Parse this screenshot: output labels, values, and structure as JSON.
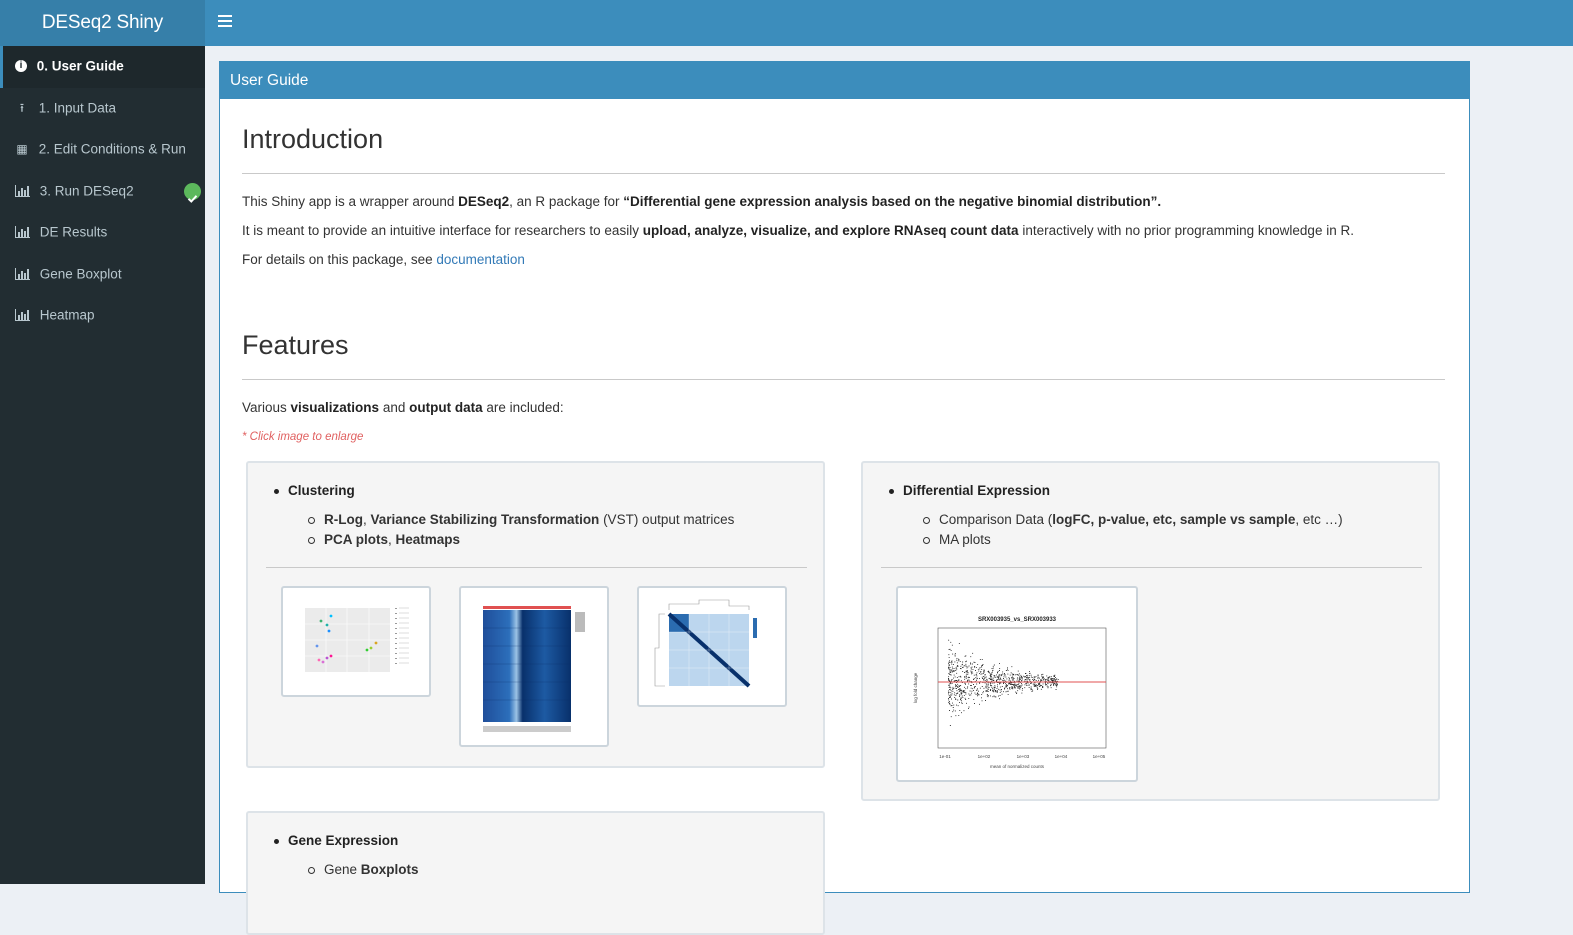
{
  "app": {
    "title": "DESeq2 Shiny"
  },
  "sidebar": {
    "items": [
      {
        "label": "0. User Guide",
        "icon": "info-circle-icon"
      },
      {
        "label": "1. Input Data",
        "icon": "upload-icon"
      },
      {
        "label": "2. Edit Conditions & Run",
        "icon": "table-icon"
      },
      {
        "label": "3. Run DESeq2",
        "icon": "bar-chart-icon",
        "status": "check-circle-icon"
      },
      {
        "label": "DE Results",
        "icon": "bar-chart-icon"
      },
      {
        "label": "Gene Boxplot",
        "icon": "bar-chart-icon"
      },
      {
        "label": "Heatmap",
        "icon": "bar-chart-icon"
      }
    ]
  },
  "box": {
    "title": "User Guide"
  },
  "intro": {
    "heading": "Introduction",
    "p1_a": "This Shiny app is a wrapper around ",
    "p1_b": "DESeq2",
    "p1_c": ", an R package for ",
    "p1_d": "“Differential gene expression analysis based on the negative binomial distribution”.",
    "p2_a": "It is meant to provide an intuitive interface for researchers to easily ",
    "p2_b": "upload, analyze, visualize, and explore RNAseq count data",
    "p2_c": " interactively with no prior programming knowledge in R.",
    "p3_a": "For details on this package, see ",
    "p3_link": "documentation"
  },
  "features": {
    "heading": "Features",
    "p_a": "Various ",
    "p_b": "visualizations",
    "p_c": " and ",
    "p_d": "output data",
    "p_e": " are included:",
    "note": "* Click image to enlarge",
    "clustering": {
      "title": "Clustering",
      "item1_a": "R-Log",
      "item1_b": ", ",
      "item1_c": "Variance Stabilizing Transformation",
      "item1_d": " (VST) output matrices",
      "item2_a": "PCA plots",
      "item2_b": ", ",
      "item2_c": "Heatmaps"
    },
    "de": {
      "title": "Differential Expression",
      "item1_a": "Comparison Data (",
      "item1_b": "logFC, p-value, etc, sample vs sample",
      "item1_c": ", etc …)",
      "item2": "MA plots",
      "ma_title": "SRX003935_vs_SRX003933",
      "ma_xlabel": "mean of normalized counts",
      "ma_ylabel": "log fold change",
      "ma_xticks": [
        "1e-01",
        "1e+02",
        "1e+03",
        "1e+04",
        "1e+05"
      ]
    },
    "gene": {
      "title": "Gene Expression",
      "item1_a": "Gene ",
      "item1_b": "Boxplots"
    }
  },
  "colors": {
    "primary": "#3c8dbc",
    "sidebar": "#222d32",
    "success": "#5cb85c"
  }
}
